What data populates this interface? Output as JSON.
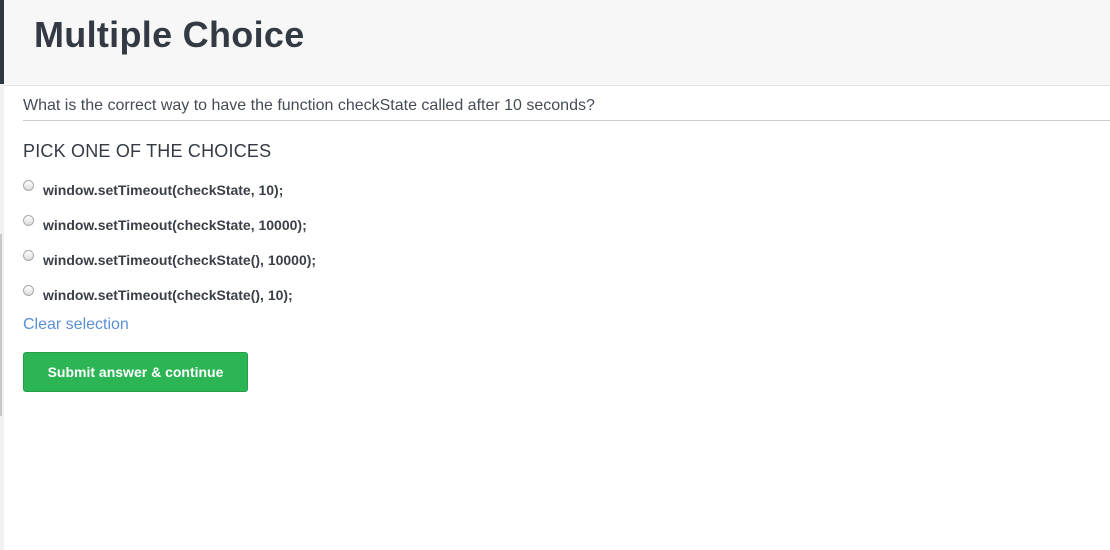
{
  "header": {
    "title": "Multiple Choice"
  },
  "question": {
    "text": "What is the correct way to have the function checkState called after 10 seconds?"
  },
  "choices_section": {
    "instruction": "PICK ONE OF THE CHOICES",
    "options": [
      {
        "label": "window.setTimeout(checkState, 10);",
        "selected": false
      },
      {
        "label": "window.setTimeout(checkState, 10000);",
        "selected": false
      },
      {
        "label": "window.setTimeout(checkState(), 10000);",
        "selected": false
      },
      {
        "label": "window.setTimeout(checkState(), 10);",
        "selected": false
      }
    ],
    "clear_label": "Clear selection"
  },
  "actions": {
    "submit_label": "Submit answer & continue"
  },
  "colors": {
    "accent_link": "#5b8fd6",
    "submit_bg": "#2cb555",
    "title_text": "#333a44",
    "header_bg": "#f7f7f7"
  }
}
